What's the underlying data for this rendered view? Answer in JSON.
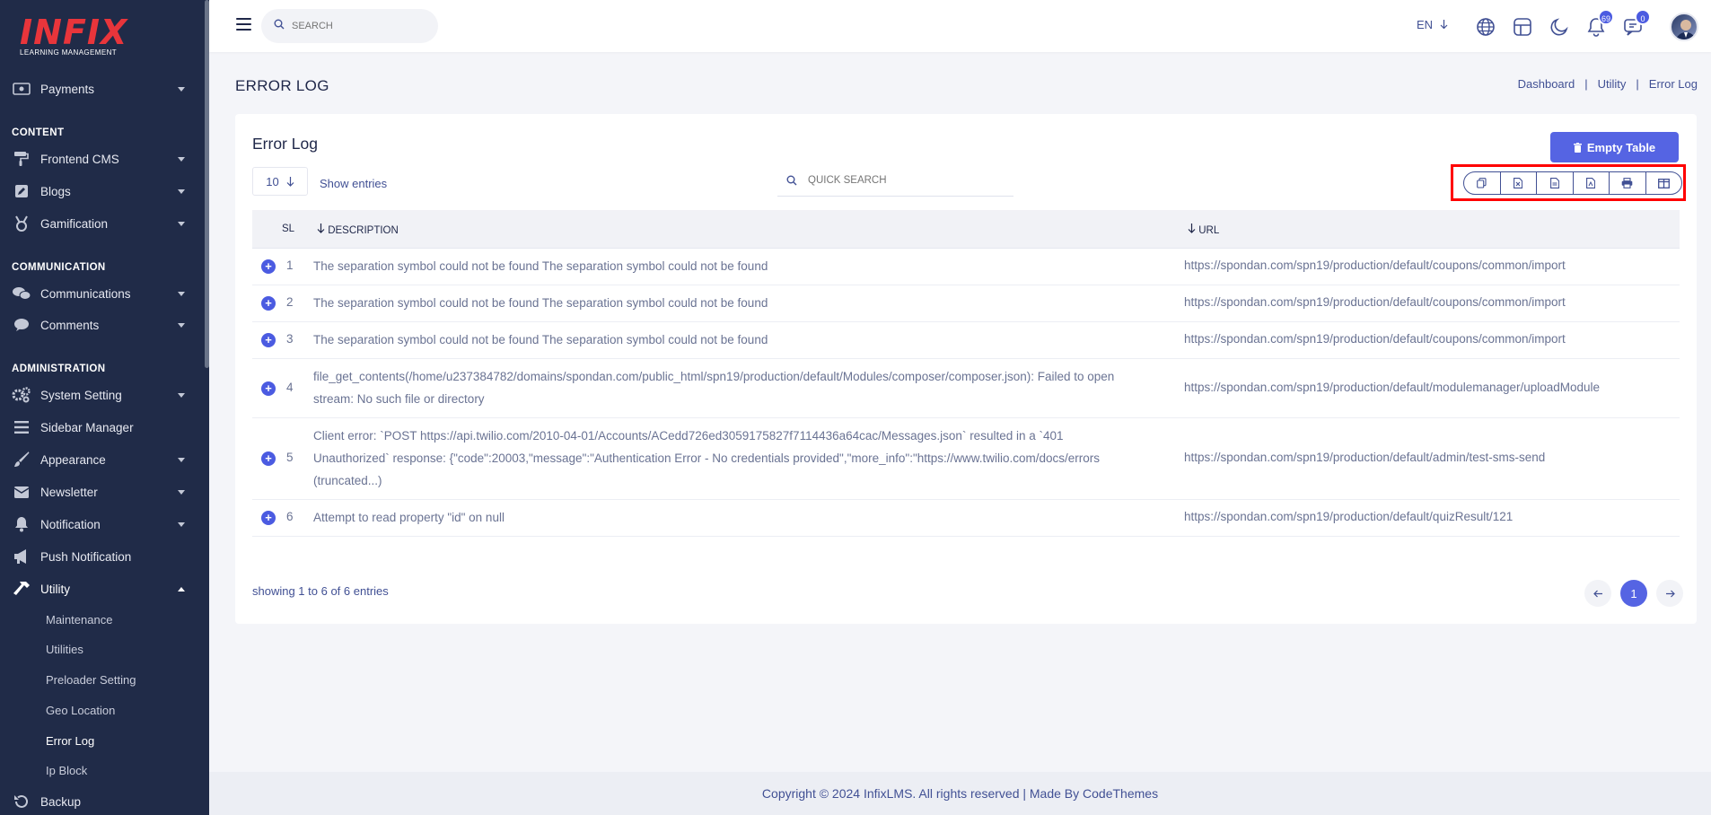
{
  "brand": {
    "logo_main": "INFIX",
    "logo_sub": "LEARNING MANAGEMENT"
  },
  "sidebar": {
    "items": [
      {
        "label": "Payments"
      },
      {
        "label": "Frontend CMS"
      },
      {
        "label": "Blogs"
      },
      {
        "label": "Gamification"
      },
      {
        "label": "Communications"
      },
      {
        "label": "Comments"
      },
      {
        "label": "System Setting"
      },
      {
        "label": "Sidebar Manager"
      },
      {
        "label": "Appearance"
      },
      {
        "label": "Newsletter"
      },
      {
        "label": "Notification"
      },
      {
        "label": "Push Notification"
      },
      {
        "label": "Utility"
      },
      {
        "label": "Backup"
      }
    ],
    "sections": [
      "CONTENT",
      "COMMUNICATION",
      "ADMINISTRATION"
    ],
    "utility_subitems": [
      "Maintenance",
      "Utilities",
      "Preloader Setting",
      "Geo Location",
      "Error Log",
      "Ip Block"
    ]
  },
  "topbar": {
    "search_placeholder": "SEARCH",
    "language": "EN",
    "notification_count": "69",
    "message_count": "0"
  },
  "page": {
    "title": "ERROR LOG",
    "breadcrumb": [
      "Dashboard",
      "Utility",
      "Error Log"
    ],
    "breadcrumb_sep": "|"
  },
  "card": {
    "title": "Error Log",
    "empty_button": "Empty Table",
    "per_page": "10",
    "show_entries": "Show entries",
    "quick_search_placeholder": "QUICK SEARCH",
    "columns": [
      "SL",
      "DESCRIPTION",
      "URL"
    ],
    "rows": [
      {
        "sl": "1",
        "desc": "The separation symbol could not be found The separation symbol could not be found",
        "url": "https://spondan.com/spn19/production/default/coupons/common/import"
      },
      {
        "sl": "2",
        "desc": "The separation symbol could not be found The separation symbol could not be found",
        "url": "https://spondan.com/spn19/production/default/coupons/common/import"
      },
      {
        "sl": "3",
        "desc": "The separation symbol could not be found The separation symbol could not be found",
        "url": "https://spondan.com/spn19/production/default/coupons/common/import"
      },
      {
        "sl": "4",
        "desc": "file_get_contents(/home/u237384782/domains/spondan.com/public_html/spn19/production/default/Modules/composer/composer.json): Failed to open stream: No such file or directory",
        "url": "https://spondan.com/spn19/production/default/modulemanager/uploadModule"
      },
      {
        "sl": "5",
        "desc": "Client error: `POST https://api.twilio.com/2010-04-01/Accounts/ACedd726ed3059175827f7114436a64cac/Messages.json` resulted in a `401 Unauthorized` response: {\"code\":20003,\"message\":\"Authentication Error - No credentials provided\",\"more_info\":\"https://www.twilio.com/docs/errors (truncated...)",
        "url": "https://spondan.com/spn19/production/default/admin/test-sms-send"
      },
      {
        "sl": "6",
        "desc": "Attempt to read property \"id\" on null",
        "url": "https://spondan.com/spn19/production/default/quizResult/121"
      }
    ],
    "showing": "showing 1 to 6 of 6 entries",
    "current_page": "1"
  },
  "footer": {
    "text": "Copyright © 2024 InfixLMS. All rights reserved | Made By CodeThemes"
  },
  "colors": {
    "sidebar_bg": "#202b48",
    "accent": "#5564e3",
    "highlight": "#ff0000"
  }
}
